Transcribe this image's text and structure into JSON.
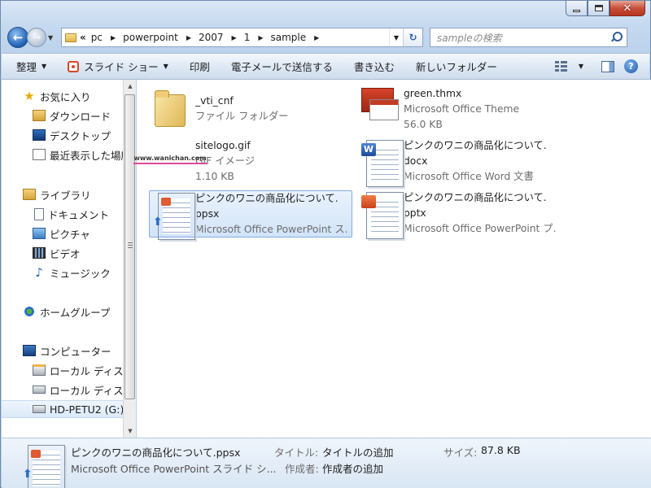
{
  "address": {
    "overflow_label": "«",
    "crumbs": [
      "pc",
      "powerpoint",
      "2007",
      "1",
      "sample"
    ]
  },
  "search": {
    "placeholder": "sampleの検索"
  },
  "toolbar": {
    "organize": "整理",
    "slideshow": "スライド ショー",
    "print": "印刷",
    "email": "電子メールで送信する",
    "burn": "書き込む",
    "new_folder": "新しいフォルダー",
    "help_glyph": "?"
  },
  "sidebar": {
    "favorites": "お気に入り",
    "downloads": "ダウンロード",
    "desktop": "デスクトップ",
    "recent": "最近表示した場所",
    "libraries": "ライブラリ",
    "documents": "ドキュメント",
    "pictures": "ピクチャ",
    "videos": "ビデオ",
    "music": "ミュージック",
    "homegroup": "ホームグループ",
    "computer": "コンピューター",
    "local_disk_1": "ローカル ディスク",
    "local_disk_2": "ローカル ディスク",
    "drive_g": "HD-PETU2 (G:)"
  },
  "files": [
    {
      "name": "_vti_cnf",
      "line2": "ファイル フォルダー",
      "line3": ""
    },
    {
      "name": "green.thmx",
      "line2": "Microsoft Office Theme",
      "line3": "56.0 KB"
    },
    {
      "name": "sitelogo.gif",
      "line2": "GIF イメージ",
      "line3": "1.10 KB",
      "logo_text": "www.wanichan.com"
    },
    {
      "name": "ピンクのワニの商品化について.",
      "line2": "docx",
      "line3": "Microsoft Office Word 文書"
    },
    {
      "name": "ピンクのワニの商品化について.",
      "line2": "ppsx",
      "line3": "Microsoft Office PowerPoint ス..."
    },
    {
      "name": "ピンクのワニの商品化について.",
      "line2": "pptx",
      "line3": "Microsoft Office PowerPoint プ..."
    }
  ],
  "details": {
    "filename": "ピンクのワニの商品化について.ppsx",
    "filetype": "Microsoft Office PowerPoint スライド シ...",
    "title_label": "タイトル:",
    "title_value": "タイトルの追加",
    "author_label": "作成者:",
    "author_value": "作成者の追加",
    "size_label": "サイズ:",
    "size_value": "87.8 KB"
  },
  "colors": {
    "accent": "#1f5fb2",
    "selection": "#d2e4f9",
    "close": "#c6503c"
  },
  "icons": {
    "back": "back-arrow-icon",
    "forward": "forward-arrow-icon",
    "refresh": "refresh-icon",
    "search": "search-icon",
    "close": "close-icon",
    "help": "help-icon"
  }
}
